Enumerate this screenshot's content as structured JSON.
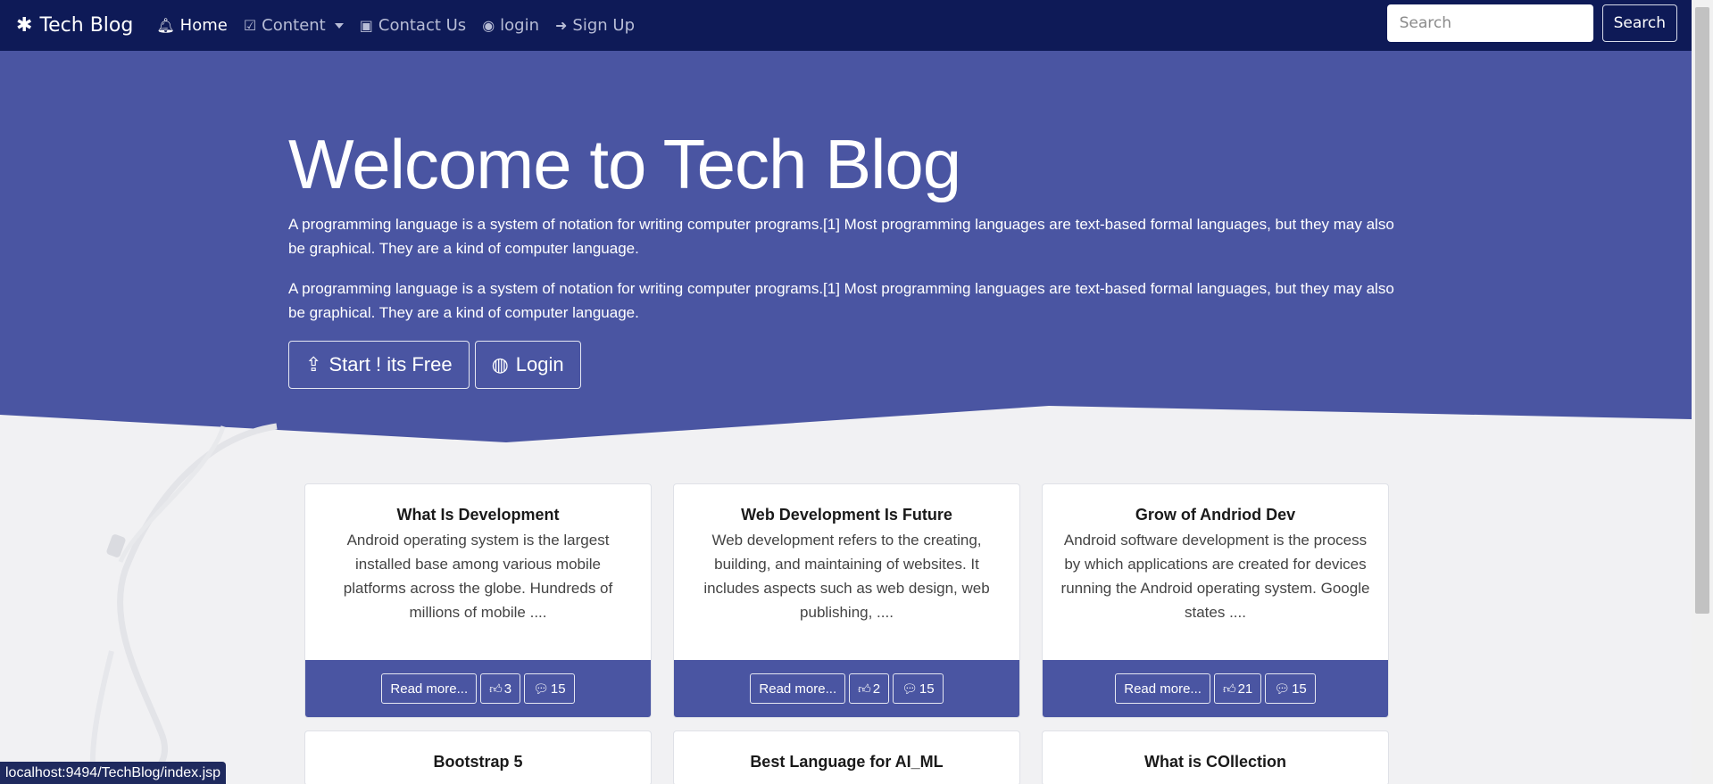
{
  "nav": {
    "brand": "Tech Blog",
    "items": [
      {
        "label": "Home",
        "icon": "bell-icon",
        "active": true
      },
      {
        "label": "Content",
        "icon": "check-square-icon",
        "dropdown": true
      },
      {
        "label": "Contact Us",
        "icon": "contact-icon"
      },
      {
        "label": "login",
        "icon": "user-circle-icon"
      },
      {
        "label": "Sign Up",
        "icon": "sign-in-icon"
      }
    ],
    "search_placeholder": "Search",
    "search_button": "Search"
  },
  "hero": {
    "title": "Welcome to Tech Blog",
    "paragraphs": [
      "A programming language is a system of notation for writing computer programs.[1] Most programming languages are text-based formal languages, but they may also be graphical. They are a kind of computer language.",
      "A programming language is a system of notation for writing computer programs.[1] Most programming languages are text-based formal languages, but they may also be graphical. They are a kind of computer language."
    ],
    "start_button": "Start ! its Free",
    "login_button": "Login"
  },
  "cards": [
    {
      "title": "What Is Development",
      "text": "Android operating system is the largest installed base among various mobile platforms across the globe. Hundreds of millions of mobile ....",
      "read_more": "Read more...",
      "likes": "3",
      "comments": "15"
    },
    {
      "title": "Web Development Is Future",
      "text": "Web development refers to the creating, building, and maintaining of websites. It includes aspects such as web design, web publishing, ....",
      "read_more": "Read more...",
      "likes": "2",
      "comments": "15"
    },
    {
      "title": "Grow of Andriod Dev",
      "text": "Android software development is the process by which applications are created for devices running the Android operating system. Google states ....",
      "read_more": "Read more...",
      "likes": "21",
      "comments": "15"
    },
    {
      "title": "Bootstrap 5"
    },
    {
      "title": "Best Language for AI_ML"
    },
    {
      "title": "What is COllection"
    }
  ],
  "status_url": "localhost:9494/TechBlog/index.jsp",
  "colors": {
    "navbar": "#0e1a57",
    "hero": "#4a55a2",
    "accent_button_border": "#e5e7f2"
  }
}
